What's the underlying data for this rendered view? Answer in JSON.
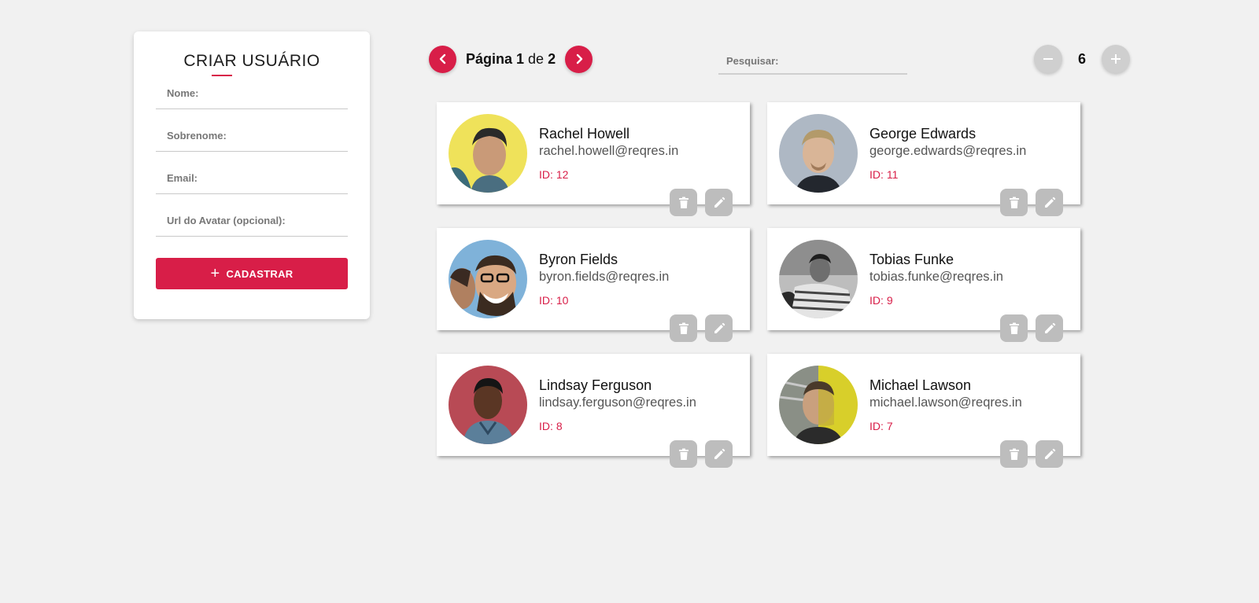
{
  "create_form": {
    "title": "CRIAR USUÁRIO",
    "fields": {
      "first_name": {
        "value": "",
        "placeholder": "Nome:"
      },
      "last_name": {
        "value": "",
        "placeholder": "Sobrenome:"
      },
      "email": {
        "value": "",
        "placeholder": "Email:"
      },
      "avatar_url": {
        "value": "",
        "placeholder": "Url do Avatar (opcional):"
      }
    },
    "submit_label": "CADASTRAR",
    "submit_icon": "plus-icon"
  },
  "pagination": {
    "page_word": "Página",
    "current_page": "1",
    "of_word": "de",
    "total_pages": "2",
    "prev_icon": "chevron-left-icon",
    "next_icon": "chevron-right-icon"
  },
  "search": {
    "value": "",
    "placeholder": "Pesquisar:"
  },
  "per_page": {
    "value": "6",
    "decrement_icon": "minus-icon",
    "increment_icon": "plus-icon"
  },
  "users": [
    {
      "name": "Rachel Howell",
      "email": "rachel.howell@reqres.in",
      "id_label": "ID:",
      "id": "12"
    },
    {
      "name": "George Edwards",
      "email": "george.edwards@reqres.in",
      "id_label": "ID:",
      "id": "11"
    },
    {
      "name": "Byron Fields",
      "email": "byron.fields@reqres.in",
      "id_label": "ID:",
      "id": "10"
    },
    {
      "name": "Tobias Funke",
      "email": "tobias.funke@reqres.in",
      "id_label": "ID:",
      "id": "9"
    },
    {
      "name": "Lindsay Ferguson",
      "email": "lindsay.ferguson@reqres.in",
      "id_label": "ID:",
      "id": "8"
    },
    {
      "name": "Michael Lawson",
      "email": "michael.lawson@reqres.in",
      "id_label": "ID:",
      "id": "7"
    }
  ],
  "card_action_icons": [
    "trash-icon",
    "pencil-icon"
  ],
  "colors": {
    "accent": "#d81e48",
    "background": "#f1f1f1",
    "card": "#ffffff",
    "muted_button": "#bdbdbd"
  }
}
